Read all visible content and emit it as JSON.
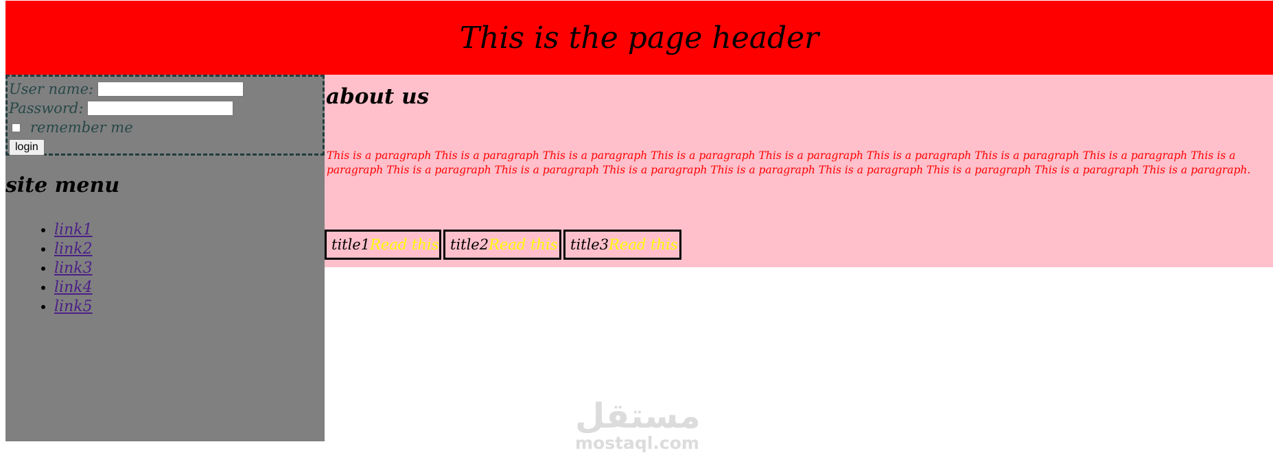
{
  "header": {
    "title": "This is the page header"
  },
  "login": {
    "username_label": "User name:",
    "username_value": "",
    "password_label": "Password:",
    "password_value": "",
    "remember_label": "remember me",
    "login_button": "login"
  },
  "menu": {
    "title": "site menu",
    "links": [
      "link1",
      "link2",
      "link3",
      "link4",
      "link5"
    ]
  },
  "main": {
    "title": "about us",
    "paragraph": "This is a paragraph This is a paragraph This is a paragraph This is a paragraph This is a paragraph This is a paragraph This is a paragraph This is a paragraph This is a paragraph This is a paragraph This is a paragraph This is a paragraph This is a paragraph This is a paragraph This is a paragraph This is a paragraph This is a paragraph.",
    "cards": [
      {
        "title": "title1",
        "link": "Read this"
      },
      {
        "title": "title2",
        "link": "Read this"
      },
      {
        "title": "title3",
        "link": "Read this"
      }
    ]
  },
  "watermark": {
    "arabic": "مستقل",
    "latin": "mostaql.com"
  },
  "colors": {
    "header_bg": "#ff0000",
    "sidebar_bg": "#808080",
    "main_bg": "#ffc0cb",
    "paragraph": "#ff0000",
    "read_link": "#ffff00",
    "menu_link": "#4b1f87"
  }
}
